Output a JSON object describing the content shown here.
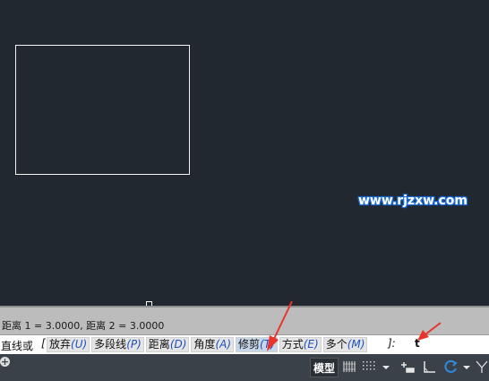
{
  "watermark": "www.rjzxw.com",
  "history": {
    "line": "距离 1 = 3.0000, 距离 2 = 3.0000"
  },
  "command": {
    "prompt": "直线或",
    "open_bracket": "[",
    "options": [
      {
        "label": "放弃",
        "key": "(U)"
      },
      {
        "label": "多段线",
        "key": "(P)"
      },
      {
        "label": "距离",
        "key": "(D)"
      },
      {
        "label": "角度",
        "key": "(A)"
      },
      {
        "label": "修剪",
        "key": "(T)"
      },
      {
        "label": "方式",
        "key": "(E)"
      },
      {
        "label": "多个",
        "key": "(M)"
      }
    ],
    "close_bracket": "]:",
    "typed_value": "t"
  },
  "statusbar": {
    "add_layout": "+",
    "model_tab": "模型",
    "icons": [
      "grid-icon",
      "snap-icon",
      "dropdown-icon",
      "ortho-icon",
      "polar-icon",
      "osnap-icon",
      "dropdown-icon",
      "linetype-icon"
    ]
  },
  "colors": {
    "canvas": "#212830",
    "annotation_arrow": "#e8342c",
    "option_key": "#1f4fbf"
  }
}
